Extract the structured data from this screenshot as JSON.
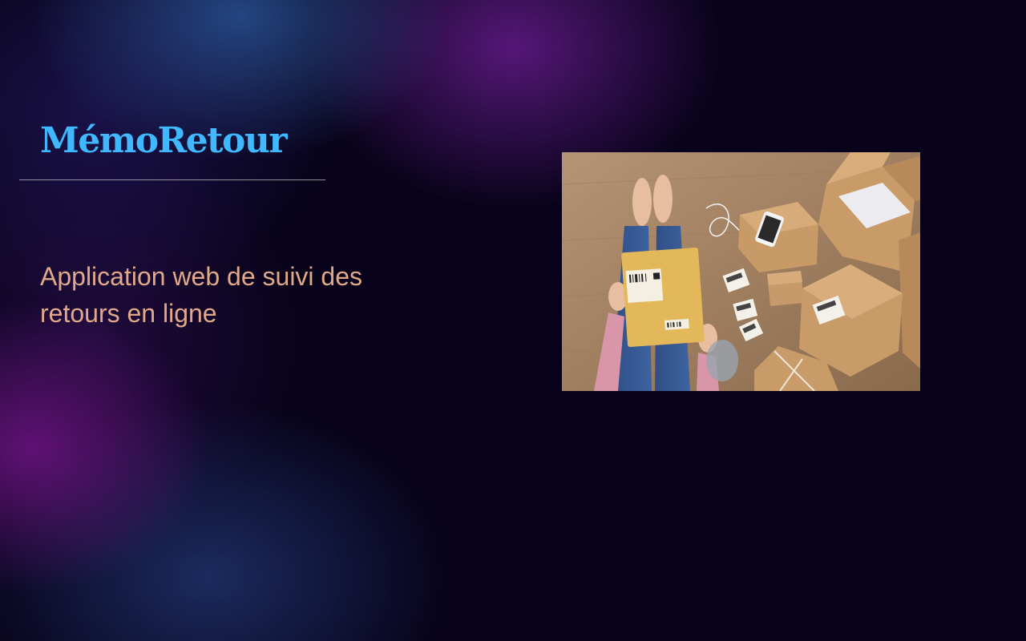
{
  "brand": {
    "name": "MémoRetour",
    "color": "#3fb8ff"
  },
  "tagline": {
    "text": "Application web de suivi des retours en ligne",
    "color": "#e0a98a"
  },
  "hero_image": {
    "icon": "parcels-photo"
  }
}
